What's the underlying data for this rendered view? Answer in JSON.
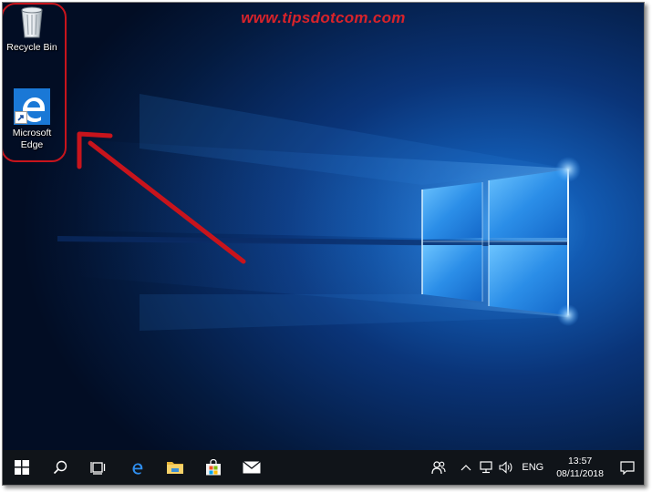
{
  "watermark": {
    "text": "www.tipsdotcom.com"
  },
  "desktop": {
    "icons": [
      {
        "label": "Recycle Bin",
        "icon": "recycle-bin-icon"
      },
      {
        "label": "Microsoft Edge",
        "icon": "edge-icon"
      }
    ]
  },
  "taskbar": {
    "buttons": [
      {
        "name": "start-button",
        "icon": "windows-logo-icon"
      },
      {
        "name": "search-button",
        "icon": "search-icon"
      },
      {
        "name": "task-view-button",
        "icon": "task-view-icon"
      },
      {
        "name": "edge-taskbar-button",
        "icon": "edge-icon"
      },
      {
        "name": "file-explorer-button",
        "icon": "folder-icon"
      },
      {
        "name": "store-button",
        "icon": "store-icon"
      },
      {
        "name": "mail-button",
        "icon": "mail-icon"
      }
    ],
    "tray": {
      "language": "ENG",
      "time": "13:57",
      "date": "08/11/2018"
    }
  },
  "colors": {
    "taskbar": "#101419",
    "accent_red": "#c8141c",
    "edge_blue": "#1a78d6",
    "wallpaper_dark": "#041a3a"
  }
}
